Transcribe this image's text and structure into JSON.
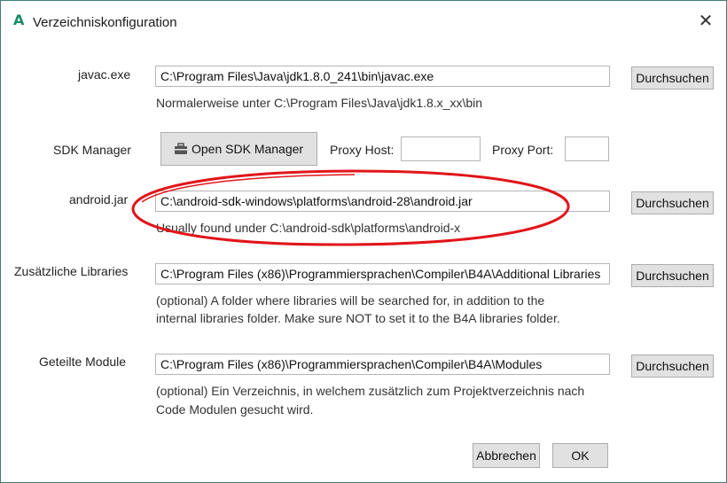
{
  "window": {
    "title": "Verzeichniskonfiguration",
    "app_icon": "A",
    "close_glyph": "✕"
  },
  "javac": {
    "label": "javac.exe",
    "value": "C:\\Program Files\\Java\\jdk1.8.0_241\\bin\\javac.exe",
    "hint": "Normalerweise unter C:\\Program Files\\Java\\jdk1.8.x_xx\\bin",
    "browse": "Durchsuchen"
  },
  "sdk": {
    "label": "SDK Manager",
    "button": "Open SDK Manager",
    "proxy_host_label": "Proxy Host:",
    "proxy_host_value": "",
    "proxy_port_label": "Proxy Port:",
    "proxy_port_value": ""
  },
  "android_jar": {
    "label": "android.jar",
    "value": "C:\\android-sdk-windows\\platforms\\android-28\\android.jar",
    "hint": "Usually found under C:\\android-sdk\\platforms\\android-x",
    "browse": "Durchsuchen"
  },
  "libraries": {
    "label": "Zusätzliche Libraries",
    "value": "C:\\Program Files (x86)\\Programmiersprachen\\Compiler\\B4A\\Additional Libraries",
    "hint_line1": "(optional) A folder where libraries will be searched for, in addition to the",
    "hint_line2": "internal libraries folder. Make sure NOT to set it to the B4A libraries folder.",
    "browse": "Durchsuchen"
  },
  "modules": {
    "label": "Geteilte Module",
    "value": "C:\\Program Files (x86)\\Programmiersprachen\\Compiler\\B4A\\Modules",
    "hint_line1": "(optional) Ein Verzeichnis, in welchem zusätzlich zum Projektverzeichnis nach",
    "hint_line2": "Code Modulen gesucht wird.",
    "browse": "Durchsuchen"
  },
  "footer": {
    "cancel": "Abbrechen",
    "ok": "OK"
  },
  "colors": {
    "accent": "#1a8a6a",
    "annotation": "#e0161b"
  }
}
